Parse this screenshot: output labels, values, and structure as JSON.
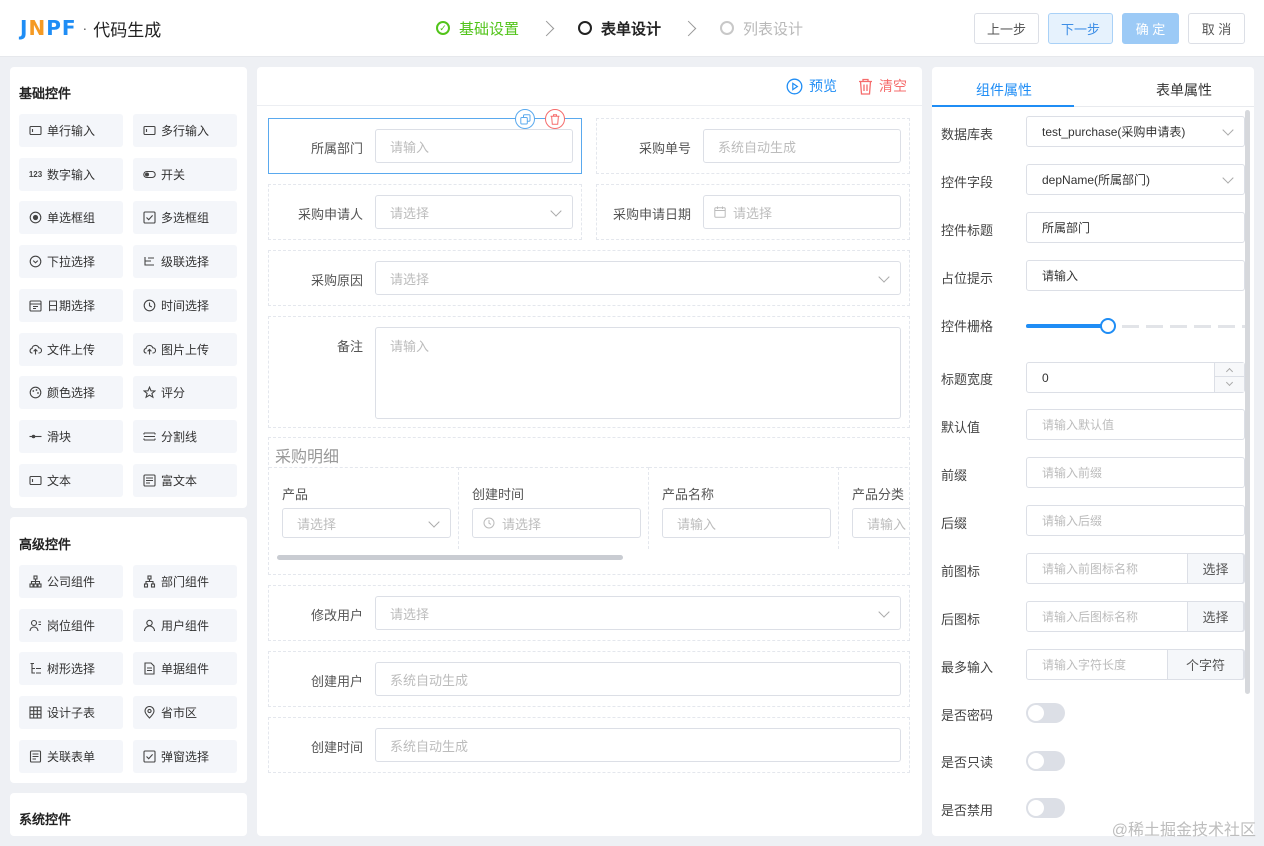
{
  "header": {
    "logo_mark_a": "J",
    "logo_mark_b": "N",
    "logo_mark_c": "PF",
    "logo_sep": "·",
    "logo_title": "代码生成",
    "steps": [
      {
        "label": "基础设置",
        "state": "done"
      },
      {
        "label": "表单设计",
        "state": "active"
      },
      {
        "label": "列表设计",
        "state": "todo"
      }
    ],
    "buttons": {
      "prev": "上一步",
      "next": "下一步",
      "confirm": "确 定",
      "cancel": "取 消"
    },
    "colors": {
      "accent": "#1f8df5",
      "done": "#52c41a",
      "next_bg": "#e6f2fd",
      "confirm_bg": "#9ccaf6"
    }
  },
  "left": {
    "basic": {
      "title": "基础控件",
      "items": [
        {
          "label": "单行输入",
          "icon": "single-line-input-icon"
        },
        {
          "label": "多行输入",
          "icon": "multi-line-input-icon"
        },
        {
          "label": "数字输入",
          "icon": "number-input-icon",
          "glyph": "123"
        },
        {
          "label": "开关",
          "icon": "switch-icon"
        },
        {
          "label": "单选框组",
          "icon": "radio-icon"
        },
        {
          "label": "多选框组",
          "icon": "checkbox-icon"
        },
        {
          "label": "下拉选择",
          "icon": "dropdown-icon"
        },
        {
          "label": "级联选择",
          "icon": "cascader-icon"
        },
        {
          "label": "日期选择",
          "icon": "date-icon"
        },
        {
          "label": "时间选择",
          "icon": "clock-icon"
        },
        {
          "label": "文件上传",
          "icon": "upload-file-icon"
        },
        {
          "label": "图片上传",
          "icon": "upload-image-icon"
        },
        {
          "label": "颜色选择",
          "icon": "palette-icon"
        },
        {
          "label": "评分",
          "icon": "star-icon"
        },
        {
          "label": "滑块",
          "icon": "slider-icon"
        },
        {
          "label": "分割线",
          "icon": "divider-icon"
        },
        {
          "label": "文本",
          "icon": "text-icon"
        },
        {
          "label": "富文本",
          "icon": "rich-text-icon"
        }
      ]
    },
    "advanced": {
      "title": "高级控件",
      "items": [
        {
          "label": "公司组件",
          "icon": "company-icon"
        },
        {
          "label": "部门组件",
          "icon": "department-icon"
        },
        {
          "label": "岗位组件",
          "icon": "position-icon"
        },
        {
          "label": "用户组件",
          "icon": "user-icon"
        },
        {
          "label": "树形选择",
          "icon": "tree-icon"
        },
        {
          "label": "单据组件",
          "icon": "document-icon"
        },
        {
          "label": "设计子表",
          "icon": "table-icon"
        },
        {
          "label": "省市区",
          "icon": "location-icon"
        },
        {
          "label": "关联表单",
          "icon": "related-form-icon"
        },
        {
          "label": "弹窗选择",
          "icon": "popup-select-icon"
        }
      ]
    },
    "system": {
      "title": "系统控件"
    }
  },
  "center": {
    "toolbar": {
      "preview": "预览",
      "clear": "清空"
    },
    "fields": {
      "dept": {
        "label": "所属部门",
        "placeholder": "请输入"
      },
      "order_no": {
        "label": "采购单号",
        "placeholder": "系统自动生成"
      },
      "applicant": {
        "label": "采购申请人",
        "placeholder": "请选择"
      },
      "apply_date": {
        "label": "采购申请日期",
        "placeholder": "请选择"
      },
      "reason": {
        "label": "采购原因",
        "placeholder": "请选择"
      },
      "remark": {
        "label": "备注",
        "placeholder": "请输入"
      },
      "modify_user": {
        "label": "修改用户",
        "placeholder": "请选择"
      },
      "create_user": {
        "label": "创建用户",
        "placeholder": "系统自动生成"
      },
      "create_time": {
        "label": "创建时间",
        "placeholder": "系统自动生成"
      }
    },
    "subtable": {
      "title": "采购明细",
      "columns": [
        {
          "header": "产品",
          "placeholder": "请选择"
        },
        {
          "header": "创建时间",
          "placeholder": "请选择"
        },
        {
          "header": "产品名称",
          "placeholder": "请输入"
        },
        {
          "header": "产品分类",
          "placeholder": "请输入"
        }
      ]
    }
  },
  "right": {
    "tabs": {
      "component": "组件属性",
      "form": "表单属性"
    },
    "props": {
      "db_table": {
        "label": "数据库表",
        "value": "test_purchase(采购申请表)"
      },
      "field": {
        "label": "控件字段",
        "value": "depName(所属部门)"
      },
      "title": {
        "label": "控件标题",
        "value": "所属部门"
      },
      "placeholder": {
        "label": "占位提示",
        "value": "请输入"
      },
      "grid": {
        "label": "控件栅格",
        "fraction": 0.375
      },
      "label_width": {
        "label": "标题宽度",
        "value": "0"
      },
      "default": {
        "label": "默认值",
        "placeholder": "请输入默认值"
      },
      "prefix": {
        "label": "前缀",
        "placeholder": "请输入前缀"
      },
      "suffix": {
        "label": "后缀",
        "placeholder": "请输入后缀"
      },
      "prefix_icon": {
        "label": "前图标",
        "placeholder": "请输入前图标名称",
        "button": "选择"
      },
      "suffix_icon": {
        "label": "后图标",
        "placeholder": "请输入后图标名称",
        "button": "选择"
      },
      "max_len": {
        "label": "最多输入",
        "placeholder": "请输入字符长度",
        "unit": "个字符"
      },
      "password": {
        "label": "是否密码",
        "on": false
      },
      "readonly": {
        "label": "是否只读",
        "on": false
      },
      "disabled": {
        "label": "是否禁用",
        "on": false
      }
    }
  },
  "watermark": "@稀土掘金技术社区"
}
